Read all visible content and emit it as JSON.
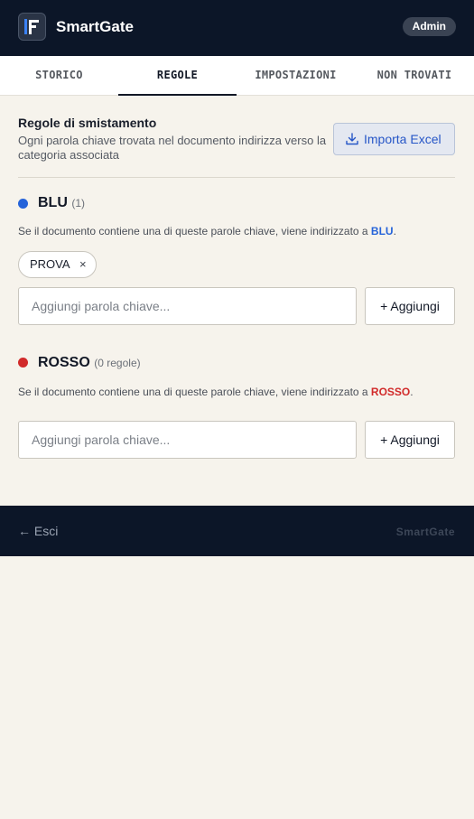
{
  "header": {
    "brand": "SmartGate",
    "badge": "Admin"
  },
  "tabs": [
    {
      "label": "STORICO",
      "active": false
    },
    {
      "label": "REGOLE",
      "active": true
    },
    {
      "label": "IMPOSTAZIONI",
      "active": false
    },
    {
      "label": "NON TROVATI",
      "active": false
    }
  ],
  "rules_section": {
    "title": "Regole di smistamento",
    "description": "Ogni parola chiave trovata nel documento indirizza verso la categoria associata",
    "import_label": "Importa Excel"
  },
  "categories": [
    {
      "name": "BLU",
      "count": "(1)",
      "color": "#2563d9",
      "desc_prefix": "Se il documento contiene una di queste parole chiave, viene indirizzato a ",
      "desc_target": "BLU",
      "desc_suffix": ".",
      "keywords": [
        "PROVA"
      ],
      "remove_symbol": "×",
      "input_placeholder": "Aggiungi parola chiave...",
      "add_label": "+ Aggiungi"
    },
    {
      "name": "ROSSO",
      "count": "(0 regole)",
      "color": "#d12a2a",
      "desc_prefix": "Se il documento contiene una di queste parole chiave, viene indirizzato a ",
      "desc_target": "ROSSO",
      "desc_suffix": ".",
      "keywords": [],
      "input_placeholder": "Aggiungi parola chiave...",
      "add_label": "+ Aggiungi"
    }
  ],
  "footer": {
    "logout_label": "← Esci",
    "brand": "SmartGate"
  },
  "icons": {
    "logo": "smartgate-logo-icon",
    "import": "download-icon"
  }
}
